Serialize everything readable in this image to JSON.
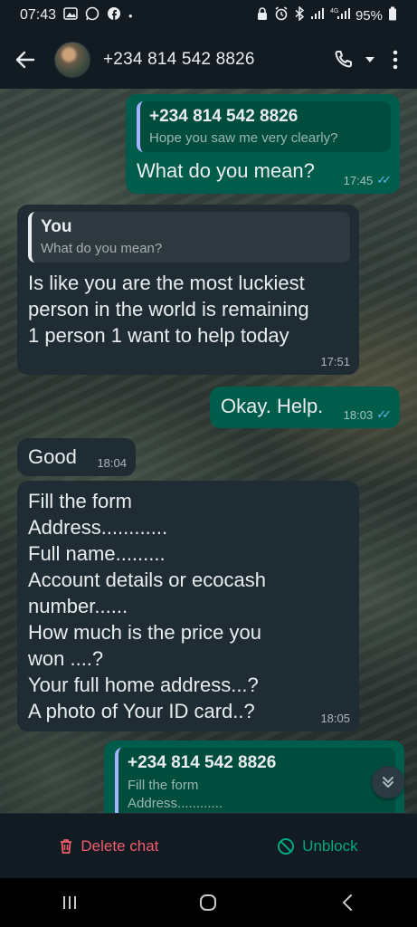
{
  "status_bar": {
    "time": "07:43",
    "left_icons": [
      "gallery-icon",
      "whatsapp-icon",
      "facebook-icon",
      "dot-icon"
    ],
    "right_icons": [
      "lock-icon",
      "alarm-icon",
      "bluetooth-icon",
      "signal-icon",
      "4g-signal-icon",
      "battery-icon"
    ],
    "battery": "95%"
  },
  "header": {
    "contact": "+234 814 542 8826",
    "icons": [
      "back-icon",
      "avatar",
      "phone-icon",
      "dropdown-icon",
      "more-icon"
    ]
  },
  "messages": [
    {
      "direction": "out",
      "quote": {
        "name": "+234 814 542 8826",
        "text": "Hope you saw me very clearly?"
      },
      "text": "What do you mean?",
      "time": "17:45",
      "read": true
    },
    {
      "direction": "in",
      "quote": {
        "name": "You",
        "text": "What do you mean?"
      },
      "text": "Is like you are the most luckiest\nperson in the world is remaining\n1 person 1 want to help today",
      "time": "17:51"
    },
    {
      "direction": "out",
      "text": "Okay. Help.",
      "time": "18:03",
      "read": true
    },
    {
      "direction": "in",
      "text": "Good",
      "time": "18:04"
    },
    {
      "direction": "in",
      "text": "Fill the form\nAddress............\nFull name.........\nAccount details or ecocash\nnumber......\nHow much is the price you\nwon ....?\nYour full home address...?\nA photo of Your ID card..?",
      "time": "18:05"
    },
    {
      "direction": "out",
      "quote": {
        "name": "+234 814 542 8826",
        "text": "Fill the form\nAddress............"
      }
    }
  ],
  "bottom_bar": {
    "delete_label": "Delete chat",
    "unblock_label": "Unblock",
    "delete_color": "#f15c6d",
    "unblock_color": "#00a884"
  },
  "nav_bar": {
    "icons": [
      "recent-apps-icon",
      "home-icon",
      "back-nav-icon"
    ]
  }
}
